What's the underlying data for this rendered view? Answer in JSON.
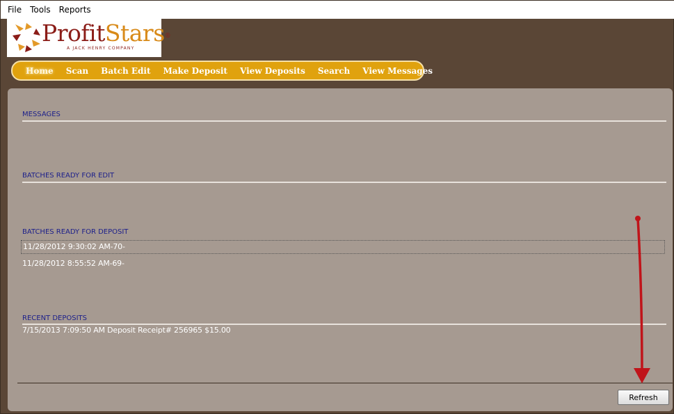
{
  "menubar": {
    "items": [
      {
        "label": "File"
      },
      {
        "label": "Tools"
      },
      {
        "label": "Reports"
      }
    ]
  },
  "logo": {
    "name_part1": "Profit",
    "name_part2": "Stars",
    "registered": "®",
    "tagline": "A JACK HENRY COMPANY"
  },
  "nav": {
    "items": [
      {
        "label": "Home",
        "active": true
      },
      {
        "label": "Scan"
      },
      {
        "label": "Batch Edit"
      },
      {
        "label": "Make Deposit"
      },
      {
        "label": "View Deposits"
      },
      {
        "label": "Search"
      },
      {
        "label": "View Messages"
      }
    ]
  },
  "sections": {
    "messages": {
      "title": "MESSAGES"
    },
    "batches_edit": {
      "title": "BATCHES READY FOR EDIT"
    },
    "batches_deposit": {
      "title": "BATCHES READY FOR DEPOSIT",
      "items": [
        {
          "label": "11/28/2012 9:30:02 AM-70-",
          "selected": true
        },
        {
          "label": "11/28/2012 8:55:52 AM-69-"
        }
      ]
    },
    "recent_deposits": {
      "title": "RECENT DEPOSITS",
      "items": [
        {
          "label": "7/15/2013 7:09:50 AM Deposit Receipt# 256965 $15.00"
        }
      ]
    }
  },
  "refresh_button": {
    "label": "Refresh"
  },
  "colors": {
    "background": "#5a4636",
    "panel": "#a69a91",
    "nav": "#e0a20e",
    "section_title": "#1c1f8a",
    "annotation_arrow": "#c0141a"
  }
}
